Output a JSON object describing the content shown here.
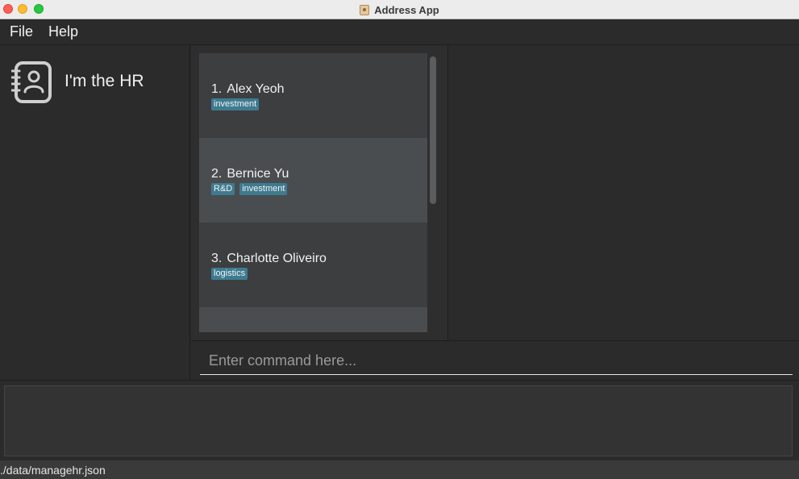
{
  "window": {
    "title": "Address App"
  },
  "menu": {
    "file": "File",
    "help": "Help"
  },
  "sidebar": {
    "app_name": "I'm the HR"
  },
  "persons": [
    {
      "index": "1.",
      "name": "Alex Yeoh",
      "tags": [
        "investment"
      ]
    },
    {
      "index": "2.",
      "name": "Bernice Yu",
      "tags": [
        "R&D",
        "investment"
      ]
    },
    {
      "index": "3.",
      "name": "Charlotte Oliveiro",
      "tags": [
        "logistics"
      ]
    }
  ],
  "command": {
    "placeholder": "Enter command here..."
  },
  "result": {
    "text": ""
  },
  "status": {
    "path": "./data/managehr.json"
  },
  "colors": {
    "background": "#2b2b2b",
    "card_odd": "#3c3e3f",
    "card_even": "#4a4d4f",
    "tag": "#3e7b91"
  }
}
